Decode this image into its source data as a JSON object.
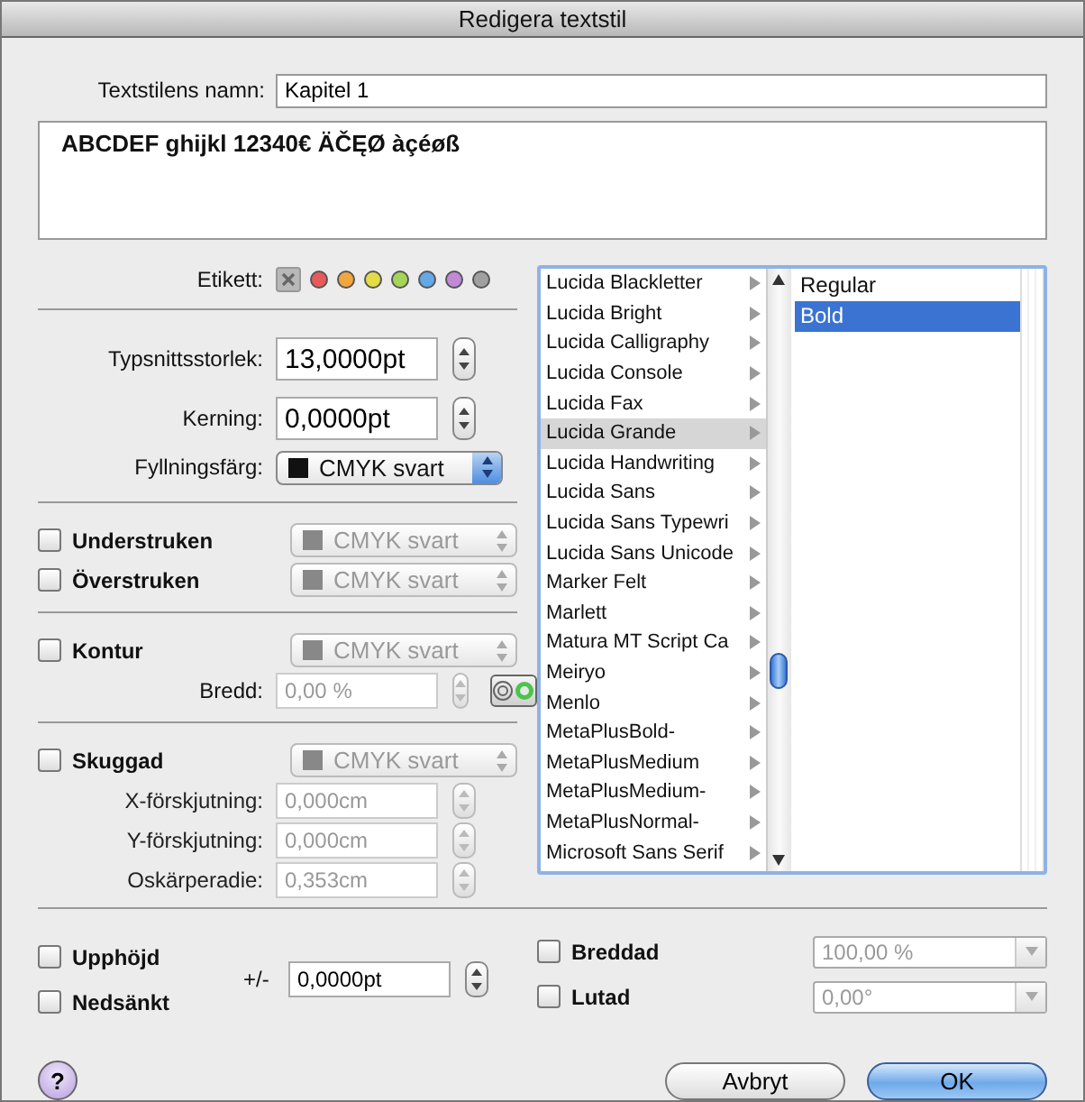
{
  "window": {
    "title": "Redigera textstil"
  },
  "name_field": {
    "label": "Textstilens namn:",
    "value": "Kapitel 1"
  },
  "preview": {
    "text": "ABCDEF ghijkl 12340€ ÄČĘØ àçéøß"
  },
  "sections": [
    [
      {
        "kind": "swatches",
        "label": "Etikett:",
        "swatches": [
          {
            "kind": "none",
            "selected": true
          },
          {
            "kind": "color",
            "color": "#e85a5a"
          },
          {
            "kind": "color",
            "color": "#f2a640"
          },
          {
            "kind": "color",
            "color": "#e4dc46"
          },
          {
            "kind": "color",
            "color": "#a6d458"
          },
          {
            "kind": "color",
            "color": "#64a8e6"
          },
          {
            "kind": "color",
            "color": "#c08ad8"
          },
          {
            "kind": "color",
            "color": "#a0a0a0"
          }
        ]
      }
    ],
    [
      {
        "kind": "large_stepper",
        "label": "Typsnittsstorlek:",
        "value": "13,0000pt"
      },
      {
        "kind": "large_stepper",
        "label": "Kerning:",
        "value": "0,0000pt"
      },
      {
        "kind": "popup",
        "label": "Fyllningsfärg:",
        "value": "CMYK svart",
        "disabled": false
      }
    ],
    [
      {
        "kind": "check_popup",
        "label": "Understruken",
        "checked": false,
        "value": "CMYK svart",
        "disabled": true
      },
      {
        "kind": "check_popup",
        "label": "Överstruken",
        "checked": false,
        "value": "CMYK svart",
        "disabled": true
      }
    ],
    [
      {
        "kind": "check_popup",
        "label": "Kontur",
        "checked": false,
        "value": "CMYK svart",
        "disabled": true
      },
      {
        "kind": "stroke_width",
        "label": "Bredd:",
        "value": "0,00 %",
        "disabled": true,
        "toggle": [
          {
            "selected": false
          },
          {
            "selected": true
          }
        ]
      }
    ],
    [
      {
        "kind": "check_popup",
        "label": "Skuggad",
        "checked": false,
        "value": "CMYK svart",
        "disabled": true
      },
      {
        "kind": "stepper",
        "label": "X-förskjutning:",
        "value": "0,000cm",
        "disabled": true
      },
      {
        "kind": "stepper",
        "label": "Y-förskjutning:",
        "value": "0,000cm",
        "disabled": true
      },
      {
        "kind": "stepper",
        "label": "Oskärperadie:",
        "value": "0,353cm",
        "disabled": true
      }
    ]
  ],
  "fonts": [
    {
      "label": "Lucida Blackletter",
      "selected": false
    },
    {
      "label": "Lucida Bright",
      "selected": false
    },
    {
      "label": "Lucida Calligraphy",
      "selected": false
    },
    {
      "label": "Lucida Console",
      "selected": false
    },
    {
      "label": "Lucida Fax",
      "selected": false
    },
    {
      "label": "Lucida Grande",
      "selected": true
    },
    {
      "label": "Lucida Handwriting",
      "selected": false
    },
    {
      "label": "Lucida Sans",
      "selected": false
    },
    {
      "label": "Lucida Sans Typewri",
      "selected": false
    },
    {
      "label": "Lucida Sans Unicode",
      "selected": false
    },
    {
      "label": "Marker Felt",
      "selected": false
    },
    {
      "label": "Marlett",
      "selected": false
    },
    {
      "label": "Matura MT Script Ca",
      "selected": false
    },
    {
      "label": "Meiryo",
      "selected": false
    },
    {
      "label": "Menlo",
      "selected": false
    },
    {
      "label": "MetaPlusBold-",
      "selected": false
    },
    {
      "label": "MetaPlusMedium",
      "selected": false
    },
    {
      "label": "MetaPlusMedium-",
      "selected": false
    },
    {
      "label": "MetaPlusNormal-",
      "selected": false
    },
    {
      "label": "Microsoft Sans Serif",
      "selected": false
    }
  ],
  "styles": [
    {
      "label": "Regular",
      "selected": false
    },
    {
      "label": "Bold",
      "selected": true
    }
  ],
  "position": {
    "options": [
      {
        "label": "Upphöjd",
        "checked": false
      },
      {
        "label": "Nedsänkt",
        "checked": false
      }
    ],
    "offset_label": "+/-",
    "offset_value": "0,0000pt"
  },
  "transforms": [
    {
      "label": "Breddad",
      "checked": false,
      "value": "100,00 %",
      "disabled": true
    },
    {
      "label": "Lutad",
      "checked": false,
      "value": "0,00°",
      "disabled": true
    }
  ],
  "help": "?",
  "buttons": [
    {
      "label": "Avbryt",
      "default": false
    },
    {
      "label": "OK",
      "default": true
    }
  ]
}
